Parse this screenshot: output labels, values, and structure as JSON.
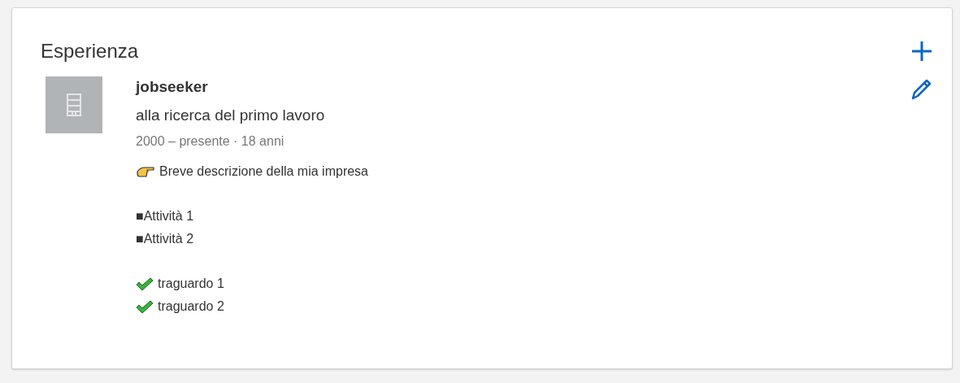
{
  "section": {
    "title": "Esperienza"
  },
  "experience": {
    "company": "jobseeker",
    "role": "alla ricerca del primo lavoro",
    "dates": "2000 – presente · 18 anni",
    "description": [
      {
        "kind": "pointer",
        "text": "Breve descrizione della mia impresa"
      },
      {
        "kind": "gap"
      },
      {
        "kind": "plain",
        "text": "■Attività 1"
      },
      {
        "kind": "plain",
        "text": "■Attività 2"
      },
      {
        "kind": "gap"
      },
      {
        "kind": "check",
        "text": "traguardo 1"
      },
      {
        "kind": "check",
        "text": "traguardo 2"
      }
    ]
  }
}
